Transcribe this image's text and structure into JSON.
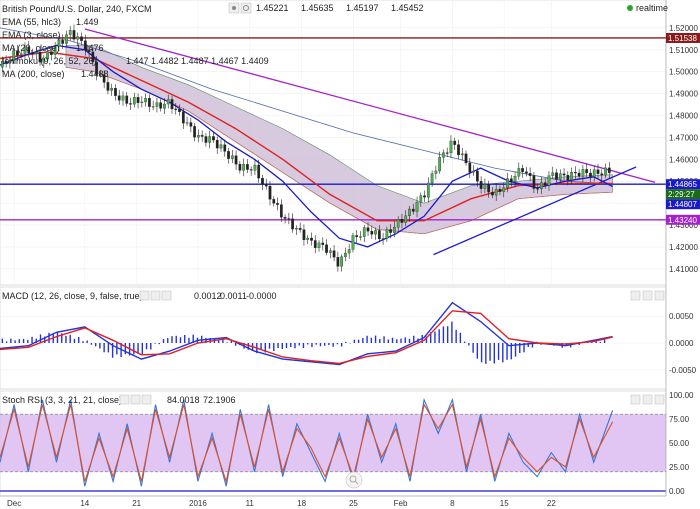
{
  "header": {
    "symbol": "British Pound/U.S. Dollar, 240, FXCM",
    "ohlc": [
      "1.45221",
      "1.45635",
      "1.45197",
      "1.45452"
    ],
    "realtime": "realtime"
  },
  "indicators": [
    {
      "name": "EMA (55, hlc3)",
      "value": "1.449",
      "color": "#ee3333"
    },
    {
      "name": "EMA (3, close)",
      "value": "",
      "color": "#ee3333"
    },
    {
      "name": "MA (20, close)",
      "value": "1.4476",
      "color": "#2233cc"
    },
    {
      "name": "Ichimoku (9, 26, 52, 26)",
      "value": "1.447 1.4482 1.4487 1.4467 1.4409",
      "color": "#444444"
    },
    {
      "name": "MA (200, close)",
      "value": "1.4488",
      "color": "#2233cc"
    }
  ],
  "price_labels": [
    {
      "text": "1.51538",
      "value": 1.51538,
      "color": "#8b1a1a"
    },
    {
      "text": "1.44865",
      "value": 1.44865,
      "color": "#1a1acc"
    },
    {
      "text": "2:29:27",
      "value": 1.4452,
      "color": "#1a6a1a"
    },
    {
      "text": "1.44807",
      "value": 1.44807,
      "color": "#1a1acc"
    },
    {
      "text": "1.43240",
      "value": 1.4324,
      "color": "#a322cc"
    }
  ],
  "macd": {
    "label": "MACD (12, 26, close, 9, false, true)",
    "values": [
      "0.0012",
      "0.0011",
      "-0.0000"
    ]
  },
  "rsi": {
    "label": "Stoch RSI (3, 3, 21, 21, close)",
    "values": [
      "84.0018",
      "72.1906"
    ]
  },
  "chart_data": {
    "type": "line",
    "title": "British Pound/U.S. Dollar, 240, FXCM",
    "x_ticks": [
      "Dec",
      "14",
      "21",
      "2016",
      "11",
      "18",
      "25",
      "Feb",
      "8",
      "15",
      "22"
    ],
    "price_axis": {
      "ticks": [
        1.52,
        1.51,
        1.5,
        1.49,
        1.48,
        1.47,
        1.46,
        1.45,
        1.44,
        1.43,
        1.42,
        1.41
      ],
      "ylim": [
        1.404,
        1.5245
      ]
    },
    "macd_axis": {
      "ticks": [
        0.005,
        0.0,
        -0.005
      ],
      "ylim": [
        -0.008,
        0.008
      ]
    },
    "rsi_axis": {
      "ticks": [
        100,
        75,
        50,
        25,
        0
      ],
      "ylim": [
        0,
        100
      ],
      "band": [
        20,
        80
      ]
    },
    "price_series": {
      "name": "GBP/USD close",
      "x": [
        0,
        3,
        6,
        9,
        12,
        15,
        18,
        21,
        24,
        27,
        30,
        33,
        36,
        39,
        42,
        45,
        48,
        51,
        54,
        57,
        60,
        63,
        66,
        69,
        72,
        75,
        78,
        81,
        84,
        87,
        90,
        93,
        96,
        99,
        102,
        105,
        108,
        111,
        114,
        117,
        120,
        123,
        126,
        129,
        130
      ],
      "values": [
        1.502,
        1.508,
        1.51,
        1.505,
        1.512,
        1.518,
        1.512,
        1.498,
        1.49,
        1.486,
        1.487,
        1.484,
        1.486,
        1.478,
        1.47,
        1.469,
        1.463,
        1.456,
        1.456,
        1.444,
        1.434,
        1.428,
        1.422,
        1.42,
        1.412,
        1.424,
        1.428,
        1.424,
        1.43,
        1.436,
        1.444,
        1.459,
        1.468,
        1.458,
        1.448,
        1.444,
        1.45,
        1.456,
        1.446,
        1.453,
        1.452,
        1.454,
        1.4535,
        1.4545,
        1.4545
      ]
    },
    "ma20": {
      "name": "MA (20, close)",
      "x": [
        0,
        6,
        12,
        18,
        24,
        30,
        36,
        42,
        48,
        54,
        60,
        66,
        72,
        78,
        84,
        90,
        96,
        102,
        108,
        114,
        120,
        126,
        130
      ],
      "values": [
        1.503,
        1.508,
        1.512,
        1.51,
        1.5,
        1.492,
        1.486,
        1.478,
        1.468,
        1.46,
        1.45,
        1.436,
        1.424,
        1.42,
        1.426,
        1.434,
        1.45,
        1.456,
        1.45,
        1.447,
        1.45,
        1.452,
        1.4476
      ]
    },
    "ema55": {
      "name": "EMA (55, hlc3)",
      "x": [
        0,
        10,
        20,
        30,
        40,
        50,
        60,
        70,
        80,
        90,
        100,
        110,
        120,
        130
      ],
      "values": [
        1.506,
        1.509,
        1.506,
        1.496,
        1.486,
        1.474,
        1.46,
        1.444,
        1.432,
        1.432,
        1.442,
        1.448,
        1.449,
        1.449
      ]
    },
    "ma200": {
      "name": "MA (200, close)",
      "x": [
        0,
        15,
        30,
        45,
        60,
        75,
        90,
        105,
        120,
        130
      ],
      "values": [
        1.52,
        1.514,
        1.504,
        1.492,
        1.482,
        1.472,
        1.464,
        1.456,
        1.45,
        1.4488
      ]
    },
    "ichimoku_cloud": {
      "name": "Ichimoku cloud",
      "x": [
        14,
        20,
        30,
        40,
        50,
        60,
        70,
        80,
        90,
        100,
        110,
        120,
        130
      ],
      "upper": [
        1.512,
        1.512,
        1.502,
        1.494,
        1.484,
        1.474,
        1.462,
        1.448,
        1.44,
        1.448,
        1.45,
        1.452,
        1.453
      ],
      "lower": [
        1.502,
        1.5,
        1.492,
        1.482,
        1.468,
        1.454,
        1.44,
        1.428,
        1.426,
        1.432,
        1.442,
        1.444,
        1.445
      ]
    },
    "levels": [
      {
        "value": 1.51538,
        "color": "#8b1a1a"
      },
      {
        "value": 1.44865,
        "color": "#1a1acc"
      },
      {
        "value": 1.4324,
        "color": "#a322cc"
      }
    ],
    "trendlines": [
      {
        "color": "#a322cc",
        "x": [
          18,
          139
        ],
        "values": [
          1.5195,
          1.4495
        ]
      },
      {
        "color": "#1a1acc",
        "x": [
          92,
          135
        ],
        "values": [
          1.4165,
          1.4565
        ]
      }
    ],
    "macd_series": {
      "x": [
        0,
        6,
        12,
        18,
        24,
        30,
        36,
        42,
        48,
        54,
        60,
        66,
        72,
        78,
        84,
        90,
        96,
        102,
        108,
        114,
        120,
        126,
        130
      ],
      "macd": [
        -0.001,
        -0.0005,
        0.002,
        0.003,
        -0.0005,
        -0.003,
        -0.0015,
        0.0005,
        0.001,
        -0.0015,
        -0.003,
        -0.0035,
        -0.004,
        -0.002,
        -0.0015,
        0.001,
        0.0075,
        0.004,
        -0.0005,
        0.0,
        -0.0005,
        0.0005,
        0.0012
      ],
      "signal": [
        -0.0012,
        -0.0008,
        0.0012,
        0.0028,
        0.0005,
        -0.0022,
        -0.002,
        0.0,
        0.0008,
        -0.0008,
        -0.0026,
        -0.0033,
        -0.0038,
        -0.0025,
        -0.0018,
        0.0005,
        0.006,
        0.0055,
        0.0008,
        0.0,
        -0.0002,
        0.0003,
        0.0011
      ]
    },
    "rsi_series": {
      "x": [
        0,
        3,
        6,
        9,
        12,
        15,
        18,
        21,
        24,
        27,
        30,
        33,
        36,
        39,
        42,
        45,
        48,
        51,
        54,
        57,
        60,
        63,
        66,
        69,
        72,
        75,
        78,
        81,
        84,
        87,
        90,
        93,
        96,
        99,
        102,
        105,
        108,
        111,
        114,
        117,
        120,
        123,
        126,
        130
      ],
      "k": [
        30,
        90,
        20,
        95,
        30,
        95,
        5,
        60,
        10,
        70,
        5,
        90,
        30,
        95,
        10,
        60,
        5,
        85,
        20,
        90,
        15,
        70,
        40,
        10,
        60,
        10,
        80,
        30,
        70,
        10,
        95,
        60,
        95,
        20,
        80,
        10,
        60,
        30,
        15,
        40,
        20,
        80,
        30,
        84
      ],
      "d": [
        35,
        85,
        25,
        90,
        35,
        90,
        10,
        55,
        15,
        65,
        10,
        85,
        35,
        90,
        15,
        55,
        10,
        80,
        25,
        85,
        20,
        65,
        45,
        15,
        55,
        15,
        75,
        35,
        65,
        15,
        90,
        65,
        90,
        25,
        75,
        15,
        55,
        35,
        20,
        35,
        25,
        75,
        35,
        72
      ]
    }
  }
}
